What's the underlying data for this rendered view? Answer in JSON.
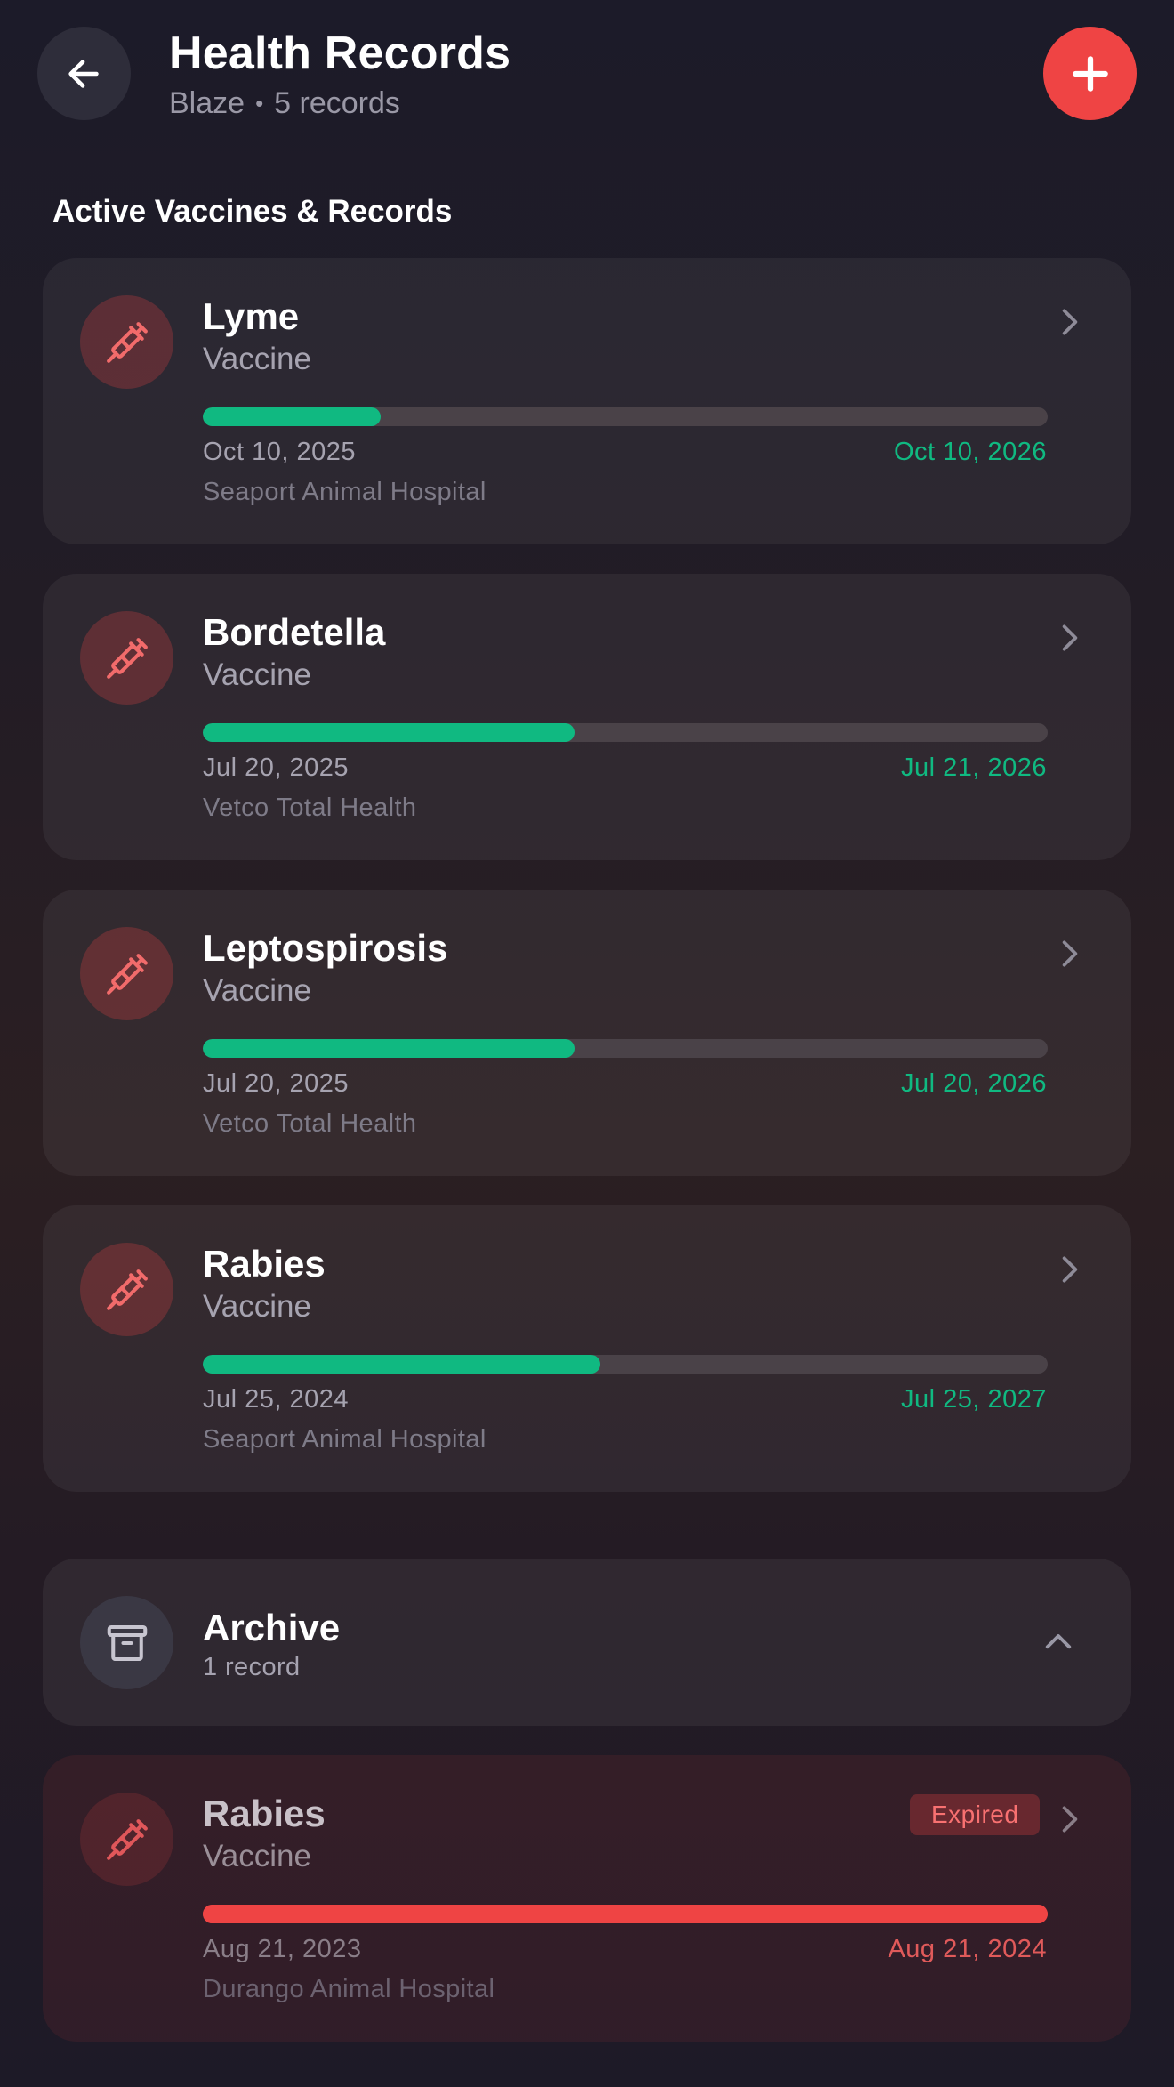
{
  "header": {
    "title": "Health Records",
    "pet_name": "Blaze",
    "separator": "•",
    "record_count_label": "5 records"
  },
  "section_title": "Active Vaccines & Records",
  "colors": {
    "accent_red": "#ef4444",
    "progress_green": "#10b981",
    "expired_red": "#ef4444"
  },
  "records": [
    {
      "name": "Lyme",
      "type": "Vaccine",
      "start_date": "Oct 10, 2025",
      "end_date": "Oct 10, 2026",
      "clinic": "Seaport Animal Hospital",
      "progress": 0.21
    },
    {
      "name": "Bordetella",
      "type": "Vaccine",
      "start_date": "Jul 20, 2025",
      "end_date": "Jul 21, 2026",
      "clinic": "Vetco Total Health",
      "progress": 0.44
    },
    {
      "name": "Leptospirosis",
      "type": "Vaccine",
      "start_date": "Jul 20, 2025",
      "end_date": "Jul 20, 2026",
      "clinic": "Vetco Total Health",
      "progress": 0.44
    },
    {
      "name": "Rabies",
      "type": "Vaccine",
      "start_date": "Jul 25, 2024",
      "end_date": "Jul 25, 2027",
      "clinic": "Seaport Animal Hospital",
      "progress": 0.47
    }
  ],
  "archive": {
    "title": "Archive",
    "count_label": "1 record",
    "expanded": true,
    "records": [
      {
        "name": "Rabies",
        "type": "Vaccine",
        "status": "Expired",
        "start_date": "Aug 21, 2023",
        "end_date": "Aug 21, 2024",
        "clinic": "Durango Animal Hospital",
        "progress": 1.0
      }
    ]
  },
  "icons": {
    "back": "arrow-left-icon",
    "add": "plus-icon",
    "record": "syringe-icon",
    "chevron": "chevron-right-icon",
    "archive": "archive-box-icon",
    "collapse": "chevron-up-icon"
  }
}
